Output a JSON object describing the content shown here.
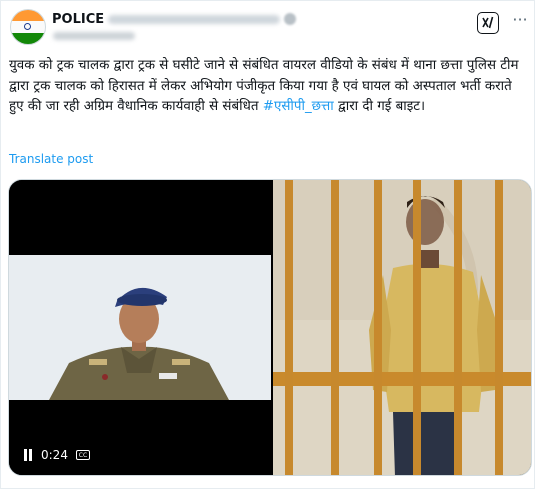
{
  "post": {
    "author_name": "POLICE",
    "text_main": "युवक को ट्रक चालक द्वारा ट्रक से घसीटे जाने से संबंधित वायरल वीडियो के संबंध में थाना छत्ता पुलिस टीम द्वारा ट्रक चालक को हिरासत में लेकर अभियोग पंजीकृत किया गया है एवं घायल को अस्पताल भर्ती कराते हुए की जा रही अग्रिम वैधानिक कार्यवाही से संबंधित ",
    "hashtag": "#एसीपी_छत्ता",
    "text_tail": " द्वारा दी गई बाइट।",
    "translate_label": "Translate post"
  },
  "header": {
    "grok_label": "x/",
    "more_label": "···"
  },
  "video": {
    "time": "0:24",
    "cc_label": "CC"
  },
  "colors": {
    "link": "#1d9bf0",
    "text": "#0f1419"
  },
  "icons": [
    "avatar-flag",
    "verified-badge-icon",
    "grok-icon",
    "more-icon",
    "pause-icon",
    "captions-icon"
  ]
}
